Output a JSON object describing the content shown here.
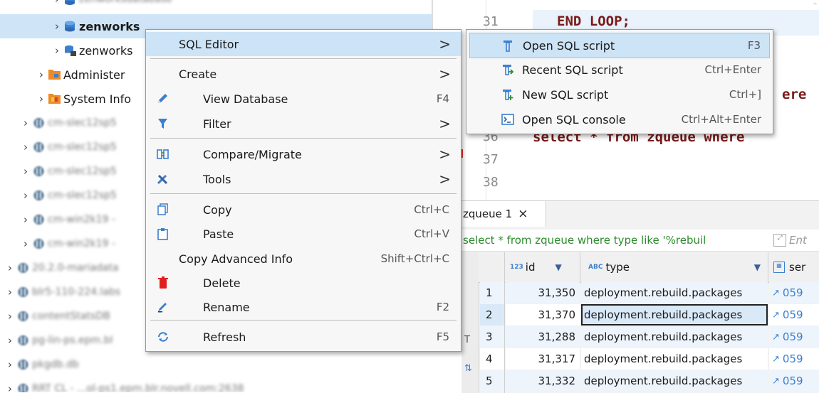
{
  "tree": {
    "rows": [
      {
        "label": "zenworks",
        "blurred": false,
        "bold": true,
        "icon": "database-icon",
        "selected": true
      },
      {
        "label": "zenworks",
        "blurred": false,
        "bold": false,
        "icon": "schema-icon"
      },
      {
        "label": "Administer",
        "blurred": false,
        "bold": false,
        "icon": "admin-folder-icon"
      },
      {
        "label": "System Info",
        "blurred": false,
        "bold": false,
        "icon": "system-folder-icon"
      },
      {
        "label": "cm-slec12sp5",
        "blurred": true
      },
      {
        "label": "cm-slec12sp5",
        "blurred": true
      },
      {
        "label": "cm-slec12sp5",
        "blurred": true
      },
      {
        "label": "cm-slec12sp5",
        "blurred": true
      },
      {
        "label": "cm-win2k19 -",
        "blurred": true
      },
      {
        "label": "cm-win2k19 -",
        "blurred": true
      },
      {
        "label": "20.2.0-mariadata",
        "blurred": true
      },
      {
        "label": "blr5-110-224.labs",
        "blurred": true
      },
      {
        "label": "contentStatsDB",
        "blurred": true
      },
      {
        "label": "pg-lin-ps.epm.bl",
        "blurred": true
      },
      {
        "label": "pkgdb.db",
        "blurred": true
      },
      {
        "label": "RRT CL - ...ol-ps1.epm.blr.novell.com:2638",
        "blurred": true
      }
    ]
  },
  "editor": {
    "lines": [
      {
        "num": "31",
        "code": "END LOOP;"
      },
      {
        "num": "36",
        "code": "select * from zqueue where"
      },
      {
        "num": "37",
        "code": ""
      },
      {
        "num": "38",
        "code": ""
      }
    ],
    "partial_code_tail": "ere"
  },
  "results": {
    "tab_label": "zqueue 1",
    "tab_close": "×",
    "query_text": "select * from zqueue where type like '%rebuil",
    "filter_placeholder": "Ent",
    "side_label": "T",
    "columns": [
      {
        "label": "id",
        "badge": "123",
        "has_dropdown": true
      },
      {
        "label": "type",
        "badge": "ABC",
        "has_dropdown": true
      },
      {
        "label": "ser",
        "badge": ""
      }
    ],
    "rows": [
      {
        "n": "1",
        "id": "31,350",
        "type": "deployment.rebuild.packages",
        "ser": "059"
      },
      {
        "n": "2",
        "id": "31,370",
        "type": "deployment.rebuild.packages",
        "ser": "059",
        "selected": true
      },
      {
        "n": "3",
        "id": "31,288",
        "type": "deployment.rebuild.packages",
        "ser": "059"
      },
      {
        "n": "4",
        "id": "31,317",
        "type": "deployment.rebuild.packages",
        "ser": "059"
      },
      {
        "n": "5",
        "id": "31,332",
        "type": "deployment.rebuild.packages",
        "ser": "059"
      }
    ]
  },
  "context_menu": {
    "items": [
      {
        "label": "SQL Editor",
        "shortcut": "",
        "arrow": ">",
        "icon": "",
        "hover": true
      },
      {
        "label": "Create",
        "shortcut": "",
        "arrow": ">",
        "icon": ""
      },
      {
        "label": "View Database",
        "shortcut": "F4",
        "arrow": "",
        "icon": "pencil-icon"
      },
      {
        "label": "Filter",
        "shortcut": "",
        "arrow": ">",
        "icon": "filter-icon"
      },
      {
        "label": "Compare/Migrate",
        "shortcut": "",
        "arrow": ">",
        "icon": "compare-icon"
      },
      {
        "label": "Tools",
        "shortcut": "",
        "arrow": ">",
        "icon": "tools-icon"
      },
      {
        "label": "Copy",
        "shortcut": "Ctrl+C",
        "arrow": "",
        "icon": "copy-icon"
      },
      {
        "label": "Paste",
        "shortcut": "Ctrl+V",
        "arrow": "",
        "icon": "paste-icon"
      },
      {
        "label": "Copy Advanced Info",
        "shortcut": "Shift+Ctrl+C",
        "arrow": "",
        "icon": ""
      },
      {
        "label": "Delete",
        "shortcut": "",
        "arrow": "",
        "icon": "delete-icon"
      },
      {
        "label": "Rename",
        "shortcut": "F2",
        "arrow": "",
        "icon": "rename-icon"
      },
      {
        "label": "Refresh",
        "shortcut": "F5",
        "arrow": "",
        "icon": "refresh-icon"
      }
    ]
  },
  "sql_submenu": {
    "items": [
      {
        "label": "Open SQL script",
        "shortcut": "F3",
        "icon": "open-script-icon",
        "hover": true
      },
      {
        "label": "Recent SQL script",
        "shortcut": "Ctrl+Enter",
        "icon": "recent-script-icon"
      },
      {
        "label": "New SQL script",
        "shortcut": "Ctrl+]",
        "icon": "new-script-icon"
      },
      {
        "label": "Open SQL console",
        "shortcut": "Ctrl+Alt+Enter",
        "icon": "console-icon"
      }
    ]
  },
  "colors": {
    "selection": "#cfe5f7",
    "menu_hover": "#cde3f6",
    "keyword": "#7a1a1a",
    "query_green": "#2e8b2e"
  }
}
